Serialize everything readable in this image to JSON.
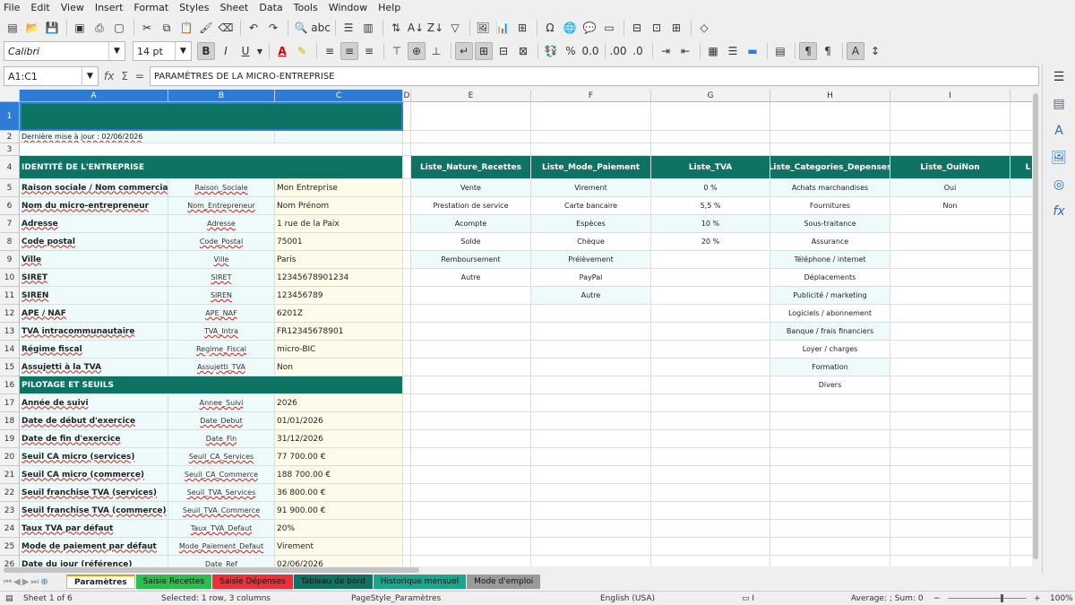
{
  "menu": [
    "File",
    "Edit",
    "View",
    "Insert",
    "Format",
    "Styles",
    "Sheet",
    "Data",
    "Tools",
    "Window",
    "Help"
  ],
  "font": {
    "name": "Calibri",
    "size": "14 pt"
  },
  "namebox": "A1:C1",
  "formula": "PARAMÈTRES DE LA MICRO-ENTREPRISE",
  "columns": [
    "A",
    "B",
    "C",
    "D",
    "E",
    "F",
    "G",
    "H",
    "I"
  ],
  "rows": [
    "1",
    "2",
    "3",
    "4",
    "5",
    "6",
    "7",
    "8",
    "9",
    "10",
    "11",
    "12",
    "13",
    "14",
    "15",
    "16",
    "17",
    "18",
    "19",
    "20",
    "21",
    "22",
    "23",
    "24",
    "25",
    "26"
  ],
  "row2": "Dernière mise à jour : 02/06/2026",
  "section1": "IDENTITÉ DE L'ENTREPRISE",
  "section2": "PILOTAGE ET SEUILS",
  "params": [
    {
      "label": "Raison sociale / Nom commercial",
      "key": "Raison_Sociale",
      "value": "Mon Entreprise"
    },
    {
      "label": "Nom du micro-entrepreneur",
      "key": "Nom_Entrepreneur",
      "value": "Nom Prénom"
    },
    {
      "label": "Adresse",
      "key": "Adresse",
      "value": "1 rue de la Paix"
    },
    {
      "label": "Code postal",
      "key": "Code_Postal",
      "value": "75001"
    },
    {
      "label": "Ville",
      "key": "Ville",
      "value": "Paris"
    },
    {
      "label": "SIRET",
      "key": "SIRET",
      "value": "12345678901234"
    },
    {
      "label": "SIREN",
      "key": "SIREN",
      "value": "123456789"
    },
    {
      "label": "APE / NAF",
      "key": "APE_NAF",
      "value": "6201Z"
    },
    {
      "label": "TVA intracommunautaire",
      "key": "TVA_Intra",
      "value": "FR12345678901"
    },
    {
      "label": "Régime fiscal",
      "key": "Regime_Fiscal",
      "value": "micro-BIC"
    },
    {
      "label": "Assujetti à la TVA",
      "key": "Assujetti_TVA",
      "value": "Non"
    }
  ],
  "params2": [
    {
      "label": "Année de suivi",
      "key": "Annee_Suivi",
      "value": "2026"
    },
    {
      "label": "Date de début d'exercice",
      "key": "Date_Debut",
      "value": "01/01/2026"
    },
    {
      "label": "Date de fin d'exercice",
      "key": "Date_Fin",
      "value": "31/12/2026"
    },
    {
      "label": "Seuil CA micro (services)",
      "key": "Seuil_CA_Services",
      "value": "77 700.00 €"
    },
    {
      "label": "Seuil CA micro (commerce)",
      "key": "Seuil_CA_Commerce",
      "value": "188 700.00 €"
    },
    {
      "label": "Seuil franchise TVA (services)",
      "key": "Seuil_TVA_Services",
      "value": "36 800.00 €"
    },
    {
      "label": "Seuil franchise TVA (commerce)",
      "key": "Seuil_TVA_Commerce",
      "value": "91 900.00 €"
    },
    {
      "label": "Taux TVA par défaut",
      "key": "Taux_TVA_Defaut",
      "value": "20%"
    },
    {
      "label": "Mode de paiement par défaut",
      "key": "Mode_Paiement_Defaut",
      "value": "Virement"
    },
    {
      "label": "Date du jour (référence)",
      "key": "Date_Ref",
      "value": "02/06/2026"
    }
  ],
  "lists": {
    "headers": [
      "Liste_Nature_Recettes",
      "Liste_Mode_Paiement",
      "Liste_TVA",
      "Liste_Categories_Depenses",
      "Liste_OuiNon",
      "L"
    ],
    "nature": [
      "Vente",
      "Prestation de service",
      "Acompte",
      "Solde",
      "Remboursement",
      "Autre"
    ],
    "mode": [
      "Virement",
      "Carte bancaire",
      "Espèces",
      "Chèque",
      "Prélèvement",
      "PayPal",
      "Autre"
    ],
    "tva": [
      "0 %",
      "5,5 %",
      "10 %",
      "20 %"
    ],
    "categories": [
      "Achats marchandises",
      "Fournitures",
      "Sous-traitance",
      "Assurance",
      "Téléphone / internet",
      "Déplacements",
      "Publicité / marketing",
      "Logiciels / abonnement",
      "Banque / frais financiers",
      "Loyer / charges",
      "Formation",
      "Divers"
    ],
    "ouinon": [
      "Oui",
      "Non"
    ]
  },
  "tabs": [
    "Paramètres",
    "Saisie Recettes",
    "Saisie Dépenses",
    "Tableau de bord",
    "Historique mensuel",
    "Mode d'emploi"
  ],
  "tabColors": [
    "#ffffff",
    "#2dbd4e",
    "#e8313a",
    "#0f7363",
    "#1aa58c",
    "#9a9a9a"
  ],
  "status": {
    "sheet": "Sheet 1 of 6",
    "selected": "Selected: 1 row, 3 columns",
    "pagestyle": "PageStyle_Paramètres",
    "lang": "English (USA)",
    "sum": "Average: ; Sum: 0",
    "zoom": "100%"
  }
}
